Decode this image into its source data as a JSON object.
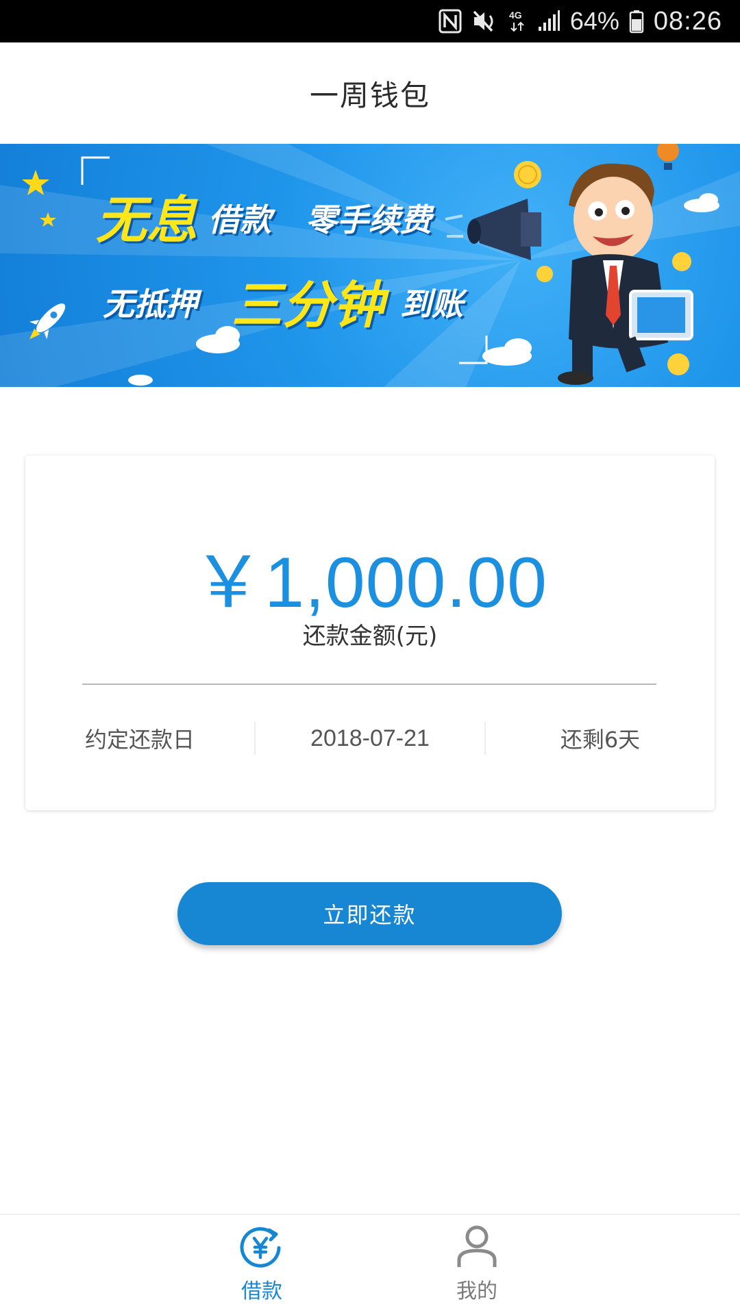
{
  "status_bar": {
    "battery": "64%",
    "time": "08:26",
    "network": "4G",
    "icons": [
      "nfc-icon",
      "mute-icon",
      "network-4g-icon",
      "signal-icon",
      "battery-icon"
    ]
  },
  "header": {
    "title": "一周钱包"
  },
  "banner": {
    "line1_highlight": "无息",
    "line1_a": "借款",
    "line1_b": "零手续费",
    "line2_a": "无抵押",
    "line2_highlight": "三分钟",
    "line2_b": "到账",
    "accent_color": "#ffe61a",
    "background_color": "#1f95ea"
  },
  "card": {
    "amount": "￥1,000.00",
    "amount_label": "还款金额(元)",
    "due_label": "约定还款日",
    "due_date": "2018-07-21",
    "days_left": "还剩6天",
    "accent_color": "#1b8fe0"
  },
  "actions": {
    "repay_now": "立即还款",
    "button_color": "#1787d3"
  },
  "bottom_nav": {
    "items": [
      {
        "label": "借款",
        "icon": "yuan-exchange-icon",
        "active": true
      },
      {
        "label": "我的",
        "icon": "user-profile-icon",
        "active": false
      }
    ]
  }
}
